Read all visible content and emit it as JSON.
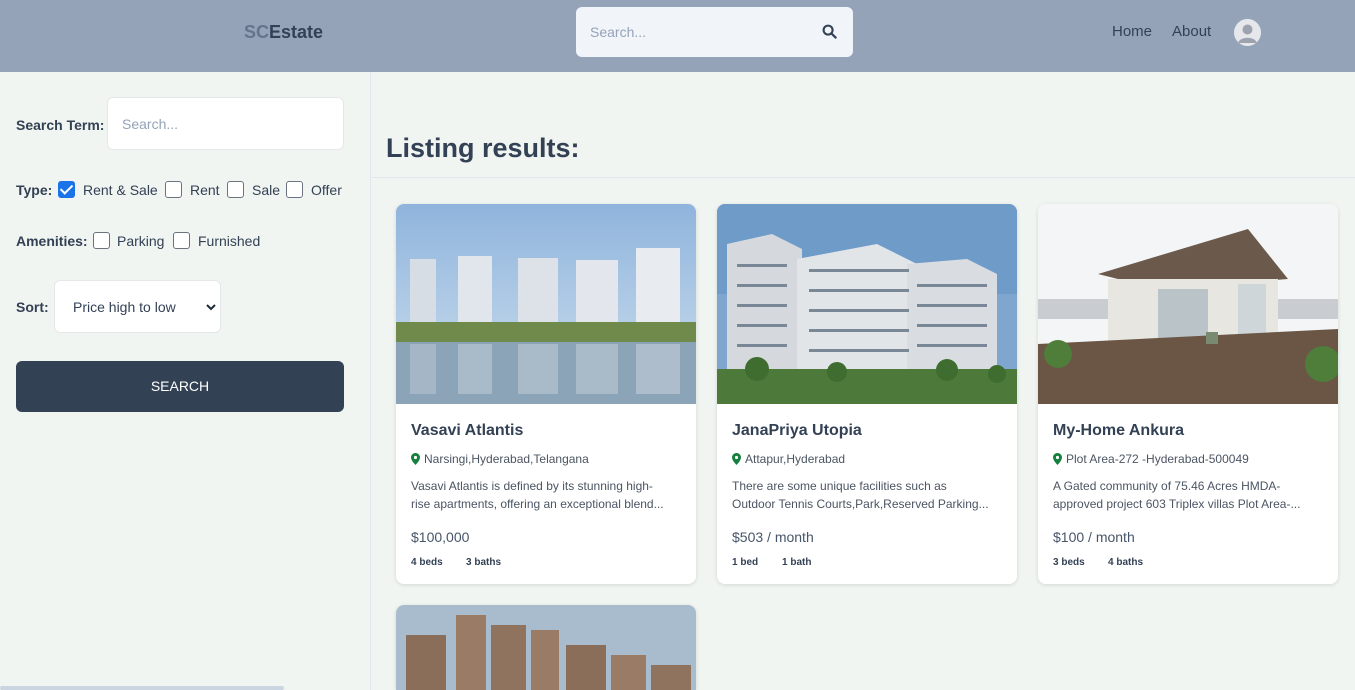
{
  "header": {
    "logo_prefix": "SC",
    "logo_suffix": "Estate",
    "search_placeholder": "Search...",
    "nav": [
      "Home",
      "About"
    ]
  },
  "sidebar": {
    "search_term_label": "Search Term:",
    "search_term_placeholder": "Search...",
    "type_label": "Type:",
    "type_options": [
      {
        "label": "Rent & Sale",
        "checked": true
      },
      {
        "label": "Rent",
        "checked": false
      },
      {
        "label": "Sale",
        "checked": false
      },
      {
        "label": "Offer",
        "checked": false
      }
    ],
    "amenities_label": "Amenities:",
    "amenities_options": [
      {
        "label": "Parking",
        "checked": false
      },
      {
        "label": "Furnished",
        "checked": false
      }
    ],
    "sort_label": "Sort:",
    "sort_selected": "Price high to low",
    "search_button": "SEARCH"
  },
  "main": {
    "title": "Listing results:",
    "listings": [
      {
        "name": "Vasavi Atlantis",
        "location": "Narsingi,Hyderabad,Telangana",
        "desc_line1": "Vasavi Atlantis is defined by its stunning high-",
        "desc_line2": "rise apartments, offering an exceptional blend...",
        "price": "$100,000",
        "beds": "4 beds",
        "baths": "3 baths"
      },
      {
        "name": "JanaPriya Utopia",
        "location": "Attapur,Hyderabad",
        "desc_line1": "There are some unique facilities such as",
        "desc_line2": "Outdoor Tennis Courts,Park,Reserved Parking...",
        "price": "$503 / month",
        "beds": "1 bed",
        "baths": "1 bath"
      },
      {
        "name": "My-Home Ankura",
        "location": "Plot Area-272 -Hyderabad-500049",
        "desc_line1": "A Gated community of 75.46 Acres HMDA-",
        "desc_line2": "approved project 603 Triplex villas Plot Area-...",
        "price": "$100 / month",
        "beds": "3 beds",
        "baths": "4 baths"
      }
    ]
  },
  "colors": {
    "header_bg": "#94a3b8",
    "page_bg": "#f1f5f1",
    "button_bg": "#334155",
    "checkbox_checked": "#1a73e8",
    "pin_green": "#15803d"
  }
}
